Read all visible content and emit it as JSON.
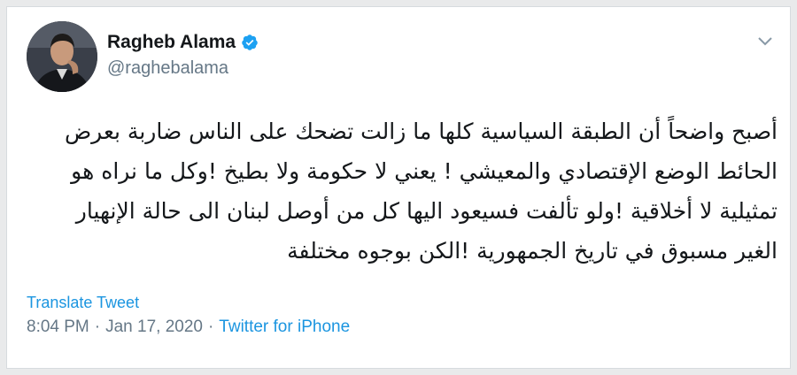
{
  "author": {
    "display_name": "Ragheb Alama",
    "handle": "@raghebalama",
    "verified_icon": "verified-badge-icon",
    "avatar_icon": "profile-photo"
  },
  "tweet": {
    "text": "أصبح واضحاً أن الطبقة السياسية كلها ما زالت تضحك على الناس ضاربة بعرض الحائط الوضع الإقتصادي والمعيشي ! يعني لا حكومة ولا بطيخ !وكل ما نراه هو تمثيلية لا أخلاقية !ولو تألفت فسيعود اليها كل من أوصل لبنان الى حالة الإنهيار الغير مسبوق في تاريخ الجمهورية !الكن بوجوه مختلفة",
    "translate_label": "Translate Tweet"
  },
  "meta": {
    "time": "8:04 PM",
    "separator": "·",
    "date": "Jan 17, 2020",
    "source": "Twitter for iPhone"
  },
  "colors": {
    "link": "#1b95e0",
    "muted": "#657786",
    "text": "#14171a"
  }
}
